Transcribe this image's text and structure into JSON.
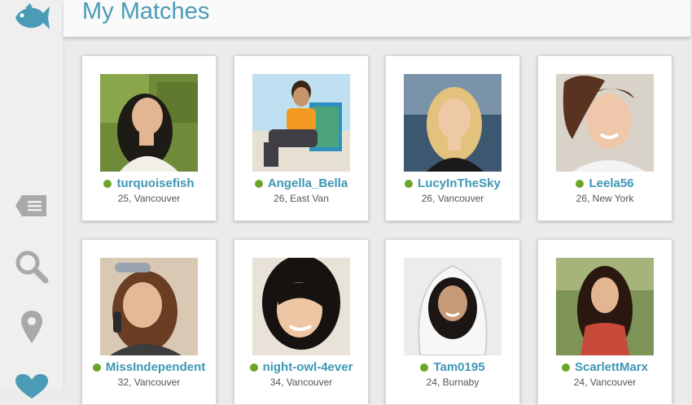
{
  "header": {
    "title": "My Matches"
  },
  "sidebar": {
    "items": [
      {
        "icon": "fish-logo-icon"
      },
      {
        "icon": "messages-icon"
      },
      {
        "icon": "search-icon"
      },
      {
        "icon": "location-pin-icon"
      },
      {
        "icon": "heart-icon"
      }
    ]
  },
  "colors": {
    "accent": "#4a9cb6",
    "online": "#6aa628"
  },
  "matches": [
    {
      "username": "turquoisefish",
      "details": "25, Vancouver"
    },
    {
      "username": "Angella_Bella",
      "details": "26, East Van"
    },
    {
      "username": "LucyInTheSky",
      "details": "26, Vancouver"
    },
    {
      "username": "Leela56",
      "details": "26, New York"
    },
    {
      "username": "MissIndependent",
      "details": "32, Vancouver"
    },
    {
      "username": "night-owl-4ever",
      "details": "34, Vancouver"
    },
    {
      "username": "Tam0195",
      "details": "24, Burnaby"
    },
    {
      "username": "ScarlettMarx",
      "details": "24, Vancouver"
    }
  ]
}
